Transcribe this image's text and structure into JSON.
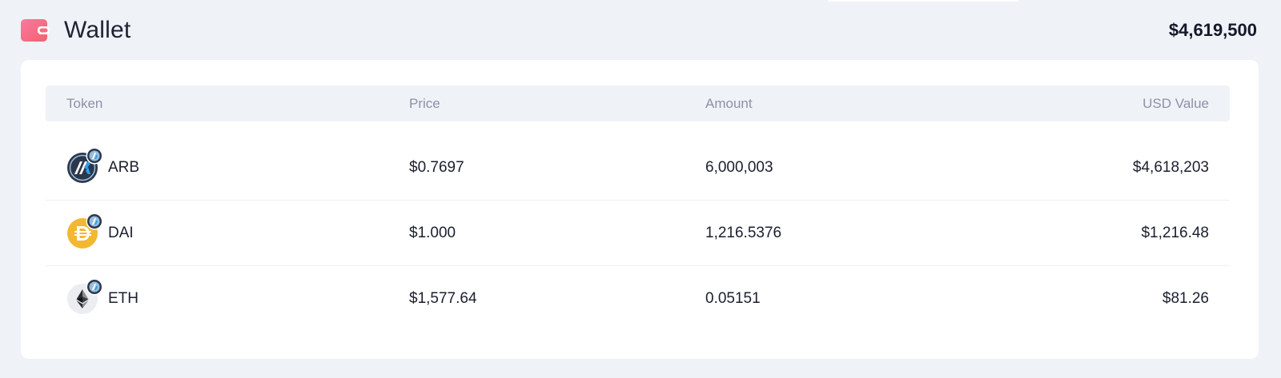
{
  "header": {
    "title": "Wallet",
    "total": "$4,619,500",
    "icon": "wallet-icon",
    "icon_color": "#f5708b"
  },
  "table": {
    "columns": {
      "token": "Token",
      "price": "Price",
      "amount": "Amount",
      "usd": "USD Value"
    },
    "rows": [
      {
        "token": "ARB",
        "price": "$0.7697",
        "amount": "6,000,003",
        "usd": "$4,618,203",
        "icon": "arb-token-icon",
        "badge": "arbitrum-network-badge-icon"
      },
      {
        "token": "DAI",
        "price": "$1.000",
        "amount": "1,216.5376",
        "usd": "$1,216.48",
        "icon": "dai-token-icon",
        "badge": "arbitrum-network-badge-icon"
      },
      {
        "token": "ETH",
        "price": "$1,577.64",
        "amount": "0.05151",
        "usd": "$81.26",
        "icon": "eth-token-icon",
        "badge": "arbitrum-network-badge-icon"
      }
    ]
  },
  "colors": {
    "page_bg": "#eff2f6",
    "card_bg": "#ffffff",
    "header_row_bg": "#eff2f7",
    "header_text": "#8b93a9",
    "dai_yellow": "#f4b731",
    "arb_navy": "#2d374b",
    "arb_blue": "#28a0f0"
  }
}
